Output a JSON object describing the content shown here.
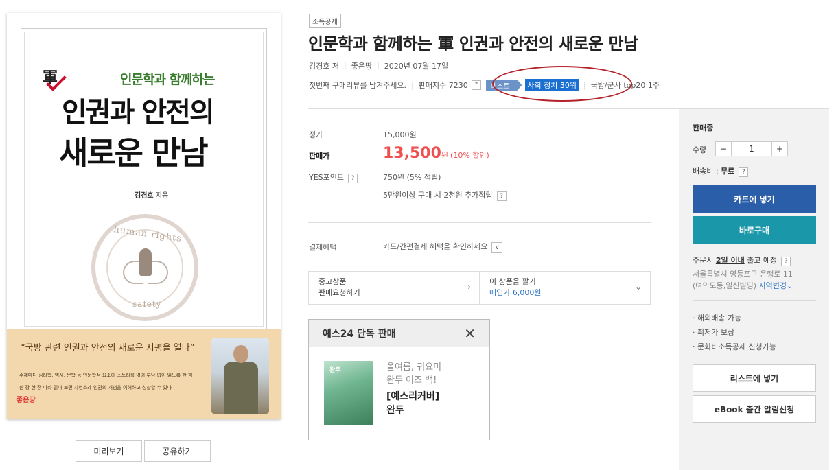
{
  "cover": {
    "mil_char": "軍",
    "subtitle": "인문학과 함께하는",
    "title_line1": "인권과 안전의",
    "title_line2": "새로운 만남",
    "author_name": "김경호",
    "author_suffix": " 지음",
    "seal_top": "human rights",
    "seal_bottom": "safety",
    "band_quote": "“국방 관련 인권과 안전의 새로운 지평을 열다”",
    "band_line1": "주제마다 심리학, 역사, 문학 등 인문학적 요소에 스토리를 엮어 부담 없이 읽도록 한 책",
    "band_line2": "한 장 한 장 따라 읽다 보면 자연스레 인권의 개념을 이해하고 성찰할 수 있다",
    "publisher_logo": "좋은땅"
  },
  "cover_buttons": {
    "preview": "미리보기",
    "share": "공유하기"
  },
  "product": {
    "tag": "소득공제",
    "title": "인문학과 함께하는 軍 인권과 안전의 새로운 만남",
    "author": "김경호 저",
    "publisher": "좋은땅",
    "date": "2020년 07월 17일",
    "review_prompt": "첫번째 구매리뷰를 남겨주세요.",
    "sales_index": "판매지수 7230",
    "help_mark": "?",
    "best_badge": "베스트",
    "best_rank": "사회 정치 30위",
    "category_rank": "국방/군사 top20 1주"
  },
  "pricing": {
    "list_label": "정가",
    "list_price": "15,000원",
    "sale_label": "판매가",
    "sale_price": "13,500",
    "sale_unit": "원",
    "sale_discount": "(10% 할인)",
    "points_label": "YES포인트",
    "points_value": "750원 (5% 적립)",
    "points_extra": "5만원이상 구매 시 2천원 추가적립",
    "payment_label": "결제혜택",
    "payment_value": "카드/간편결제 혜택을 확인하세요"
  },
  "used": {
    "left_line1": "중고상품",
    "left_line2": "판매요청하기",
    "right_line1": "이 상품을 팔기",
    "right_line2": "매입가 6,000원"
  },
  "exclusive": {
    "header": "예스24 단독 판매",
    "thumb_title": "완두",
    "line1": "올여름, 귀요미",
    "line2": "완두 이즈 백!",
    "name1": "[예스리커버]",
    "name2": "완두"
  },
  "panel": {
    "status": "판매중",
    "qty_label": "수량",
    "qty_minus": "−",
    "qty_value": "1",
    "qty_plus": "+",
    "ship_label": "배송비 : ",
    "ship_value": "무료",
    "cart": "카트에 넣기",
    "buy": "바로구매",
    "deliv_prefix": "주문시 ",
    "deliv_emph": "2일 이내",
    "deliv_suffix": " 출고 예정",
    "addr_line1": "서울특별시 영등포구 은행로 11",
    "addr_line2": "(여의도동,일신빌딩)",
    "addr_change": "지역변경",
    "feat1": "· 해외배송 가능",
    "feat2": "· 최저가 보상",
    "feat3": "· 문화비소득공제 신청가능",
    "list_btn": "리스트에 넣기",
    "ebook_btn": "eBook 출간 알림신청"
  },
  "colors": {
    "sale_red": "#f04f4f",
    "cart_blue": "#2b5ea8",
    "buy_teal": "#1a97a8",
    "rank_blue": "#1a6fd0",
    "highlight_circle": "#b4232a"
  }
}
